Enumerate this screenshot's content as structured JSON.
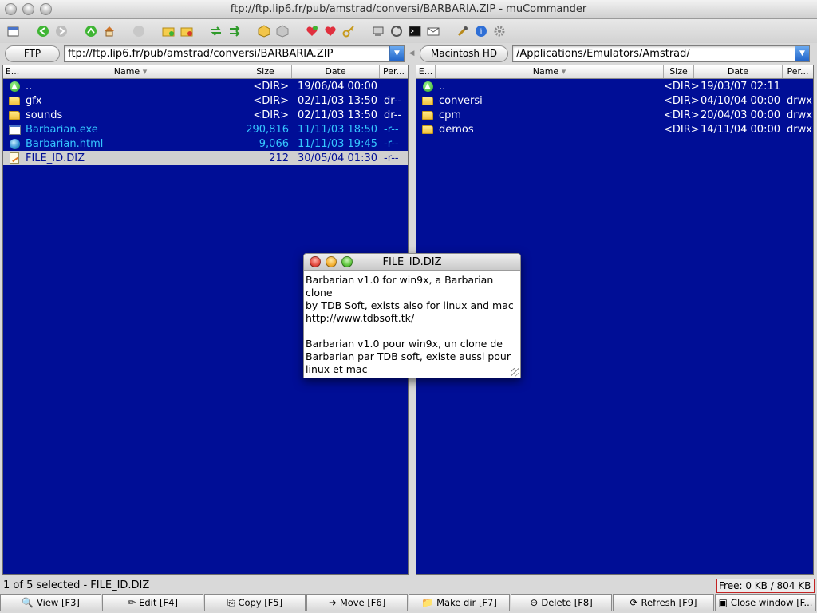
{
  "window": {
    "title": "ftp://ftp.lip6.fr/pub/amstrad/conversi/BARBARIA.ZIP - muCommander"
  },
  "toolbar": {
    "icons": [
      "new-window-icon",
      "back-icon",
      "forward-icon",
      "parent-folder-icon",
      "home-icon",
      "stop-icon",
      "new-folder-icon",
      "bookmark-folder-icon",
      "swap-panels-icon",
      "set-same-folder-icon",
      "pack-icon",
      "unpack-icon",
      "add-bookmark-icon",
      "edit-bookmarks-icon",
      "connect-server-icon",
      "run-command-icon",
      "sync-icon",
      "terminal-icon",
      "email-icon",
      "preferences-icon",
      "about-icon",
      "settings-gear-icon"
    ]
  },
  "left": {
    "drive": "FTP",
    "path": "ftp://ftp.lip6.fr/pub/amstrad/conversi/BARBARIA.ZIP",
    "columns": {
      "ext": "E...",
      "name": "Name",
      "size": "Size",
      "date": "Date",
      "perm": "Per..."
    },
    "rows": [
      {
        "icon": "up",
        "name": "..",
        "size": "<DIR>",
        "date": "19/06/04 00:00",
        "perm": "",
        "link": false,
        "selected": false
      },
      {
        "icon": "folder",
        "name": "gfx",
        "size": "<DIR>",
        "date": "02/11/03 13:50",
        "perm": "dr--",
        "link": false,
        "selected": false
      },
      {
        "icon": "folder",
        "name": "sounds",
        "size": "<DIR>",
        "date": "02/11/03 13:50",
        "perm": "dr--",
        "link": false,
        "selected": false
      },
      {
        "icon": "exe",
        "name": "Barbarian.exe",
        "size": "290,816",
        "date": "11/11/03 18:50",
        "perm": "-r--",
        "link": true,
        "selected": false
      },
      {
        "icon": "html",
        "name": "Barbarian.html",
        "size": "9,066",
        "date": "11/11/03 19:45",
        "perm": "-r--",
        "link": true,
        "selected": false
      },
      {
        "icon": "file",
        "name": "FILE_ID.DIZ",
        "size": "212",
        "date": "30/05/04 01:30",
        "perm": "-r--",
        "link": false,
        "selected": true
      }
    ]
  },
  "right": {
    "drive": "Macintosh HD",
    "path": "/Applications/Emulators/Amstrad/",
    "columns": {
      "ext": "E...",
      "name": "Name",
      "size": "Size",
      "date": "Date",
      "perm": "Per..."
    },
    "rows": [
      {
        "icon": "up",
        "name": "..",
        "size": "<DIR>",
        "date": "19/03/07 02:11",
        "perm": "",
        "link": false,
        "selected": false
      },
      {
        "icon": "folder",
        "name": "conversi",
        "size": "<DIR>",
        "date": "04/10/04 00:00",
        "perm": "drwx",
        "link": false,
        "selected": false
      },
      {
        "icon": "folder",
        "name": "cpm",
        "size": "<DIR>",
        "date": "20/04/03 00:00",
        "perm": "drwx",
        "link": false,
        "selected": false
      },
      {
        "icon": "folder",
        "name": "demos",
        "size": "<DIR>",
        "date": "14/11/04 00:00",
        "perm": "drwx",
        "link": false,
        "selected": false
      }
    ]
  },
  "popup": {
    "title": "FILE_ID.DIZ",
    "content": "Barbarian v1.0 for win9x, a Barbarian clone\nby TDB Soft, exists also for linux and mac\nhttp://www.tdbsoft.tk/\n\nBarbarian v1.0 pour win9x, un clone de\nBarbarian par TDB soft, existe aussi pour\nlinux et mac"
  },
  "status": {
    "selection": "1 of 5 selected - FILE_ID.DIZ",
    "free": "Free: 0 KB / 804 KB"
  },
  "buttons": [
    {
      "icon": "view-icon",
      "glyph": "🔍",
      "label": "View [F3]"
    },
    {
      "icon": "edit-icon",
      "glyph": "✏",
      "label": "Edit [F4]"
    },
    {
      "icon": "copy-icon",
      "glyph": "⎘",
      "label": "Copy [F5]"
    },
    {
      "icon": "move-icon",
      "glyph": "➜",
      "label": "Move [F6]"
    },
    {
      "icon": "make-dir-icon",
      "glyph": "📁",
      "label": "Make dir [F7]"
    },
    {
      "icon": "delete-icon",
      "glyph": "⊖",
      "label": "Delete [F8]"
    },
    {
      "icon": "refresh-icon",
      "glyph": "⟳",
      "label": "Refresh [F9]"
    },
    {
      "icon": "close-window-icon",
      "glyph": "▣",
      "label": "Close window [F..."
    }
  ],
  "colors": {
    "panel_bg": "#000e96",
    "file_text": "#ffffff",
    "link_text": "#35c6ff",
    "selection_bg": "#d0d0d0"
  }
}
